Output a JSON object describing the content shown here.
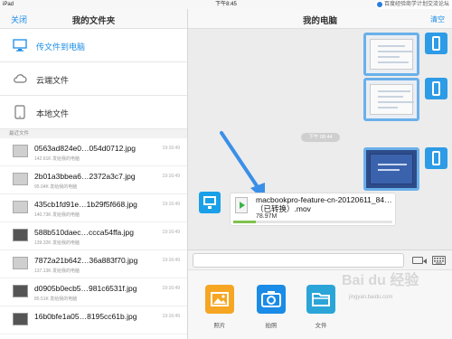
{
  "status_bar": {
    "device": "iPad",
    "time": "下午8:45",
    "badge": "百度经验商学计划交流论坛"
  },
  "left": {
    "close_label": "关闭",
    "title": "我的文件夹",
    "menu": [
      {
        "label": "传文件到电脑",
        "icon": "monitor-icon",
        "active": true
      },
      {
        "label": "云端文件",
        "icon": "cloud-icon",
        "active": false
      },
      {
        "label": "本地文件",
        "icon": "tablet-icon",
        "active": false
      }
    ],
    "section_header": "最近文件",
    "files": [
      {
        "name": "0563ad824e0…054d0712.jpg",
        "meta": "142.61K  发给我的电脑",
        "time": "19:16:49",
        "kind": "photo"
      },
      {
        "name": "2b01a3bbea6…2372a3c7.jpg",
        "meta": "95.04K  发给我的电脑",
        "time": "19:16:49",
        "kind": "photo"
      },
      {
        "name": "435cb1fd91e…1b29f5f668.jpg",
        "meta": "140.73K  发给我的电脑",
        "time": "19:16:49",
        "kind": "photo"
      },
      {
        "name": "588b510daec…ccca54ffa.jpg",
        "meta": "139.32K  发给我的电脑",
        "time": "19:16:49",
        "kind": "dark"
      },
      {
        "name": "7872a21b642…36a883f70.jpg",
        "meta": "137.13K  发给我的电脑",
        "time": "19:16:49",
        "kind": "photo"
      },
      {
        "name": "d0905b0ecb5…981c6531f.jpg",
        "meta": "85.51K  发给我的电脑",
        "time": "19:16:49",
        "kind": "dark"
      },
      {
        "name": "16b0bfe1a05…8195cc61b.jpg",
        "meta": "",
        "time": "19:16:49",
        "kind": "dark"
      }
    ]
  },
  "right": {
    "title": "我的电脑",
    "clear_label": "清空",
    "time_pill": "下午 08:44",
    "file_message": {
      "name": "macbookpro-feature-cn-20120611_84…（已转换）.mov",
      "size": "78.97M",
      "progress": 0.14
    },
    "input_placeholder": "",
    "actions": [
      {
        "label": "照片",
        "icon": "photo-icon"
      },
      {
        "label": "拍照",
        "icon": "camera-icon"
      },
      {
        "label": "文件",
        "icon": "folder-icon"
      }
    ]
  },
  "watermark": {
    "text": "Bai du 经验",
    "url": "jingyan.baidu.com"
  },
  "colors": {
    "accent": "#1a8be6",
    "progress": "#7fc24d",
    "arrow": "#3a8fe8",
    "photo_button": "#f6a623"
  }
}
